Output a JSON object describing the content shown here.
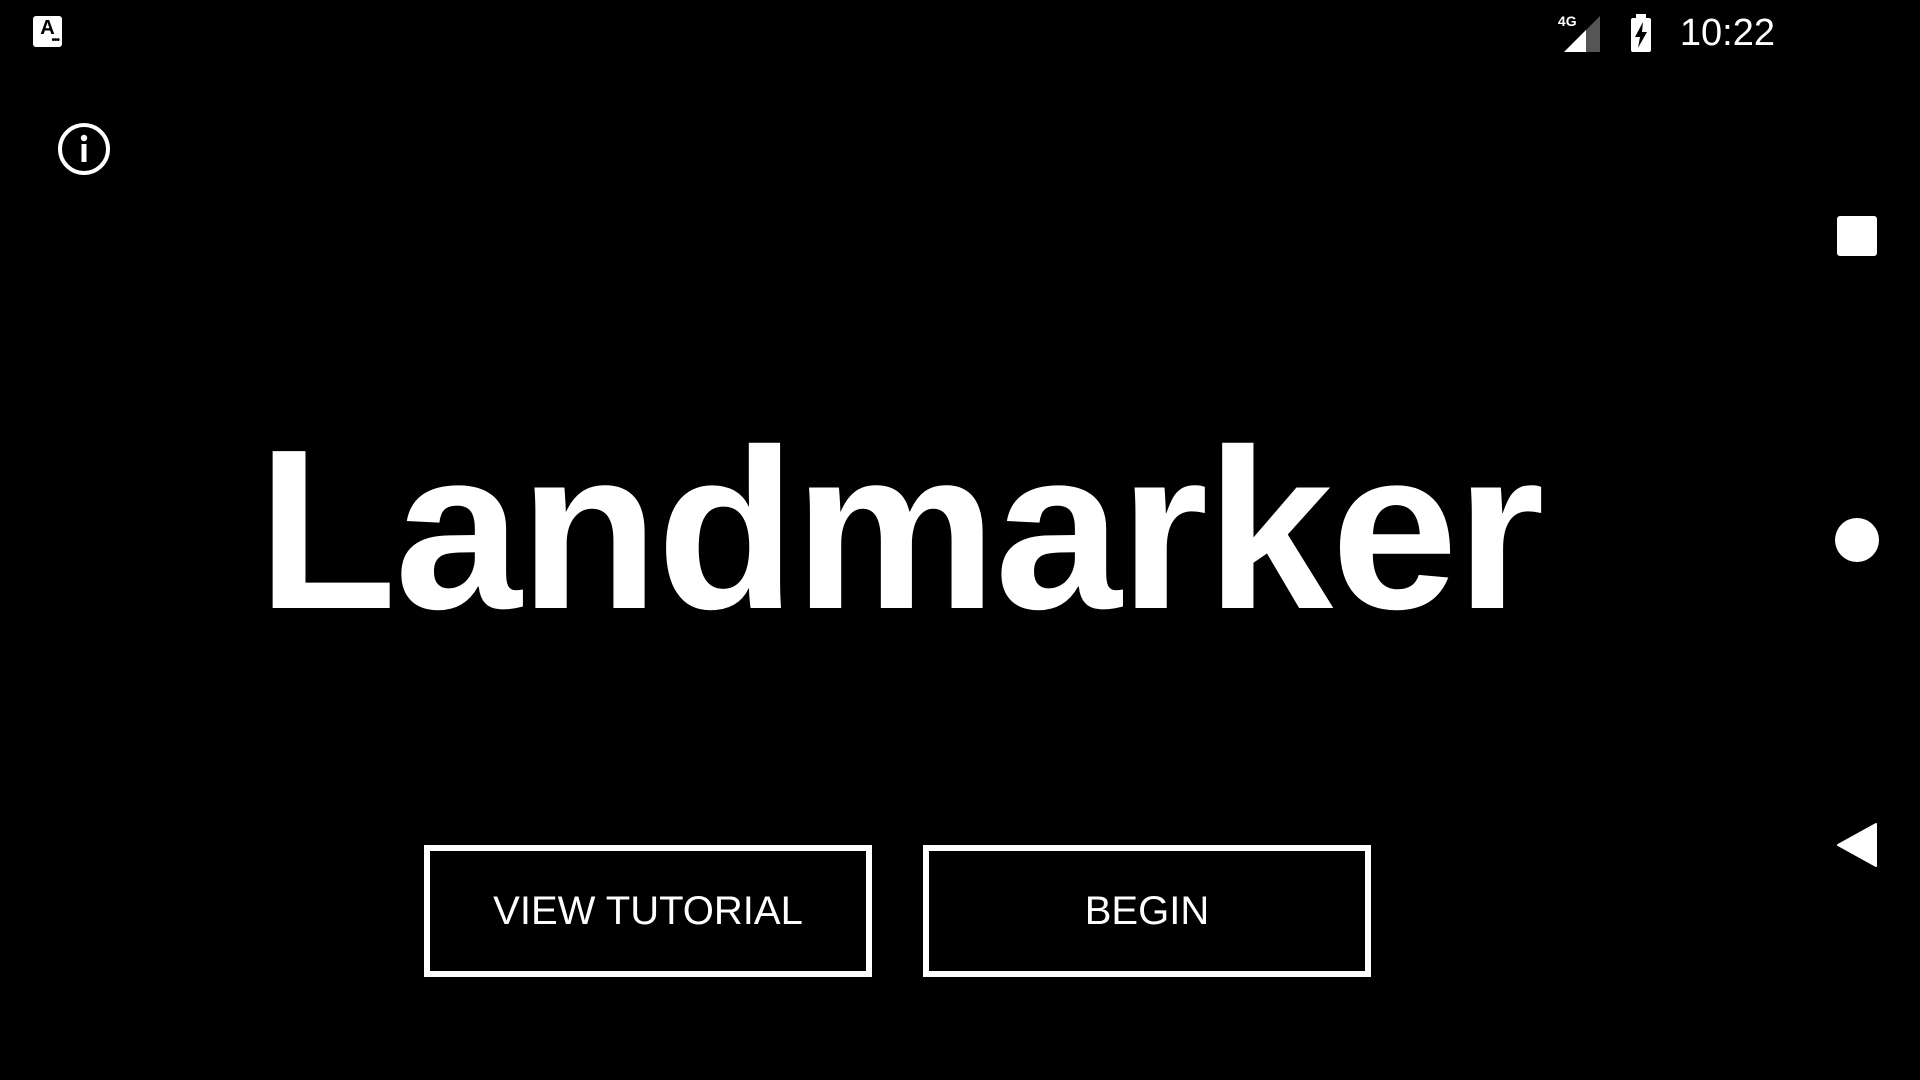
{
  "status_bar": {
    "app_icon_letter": "A",
    "network_type": "4G",
    "time": "10:22",
    "icons": [
      "accessibility-app-icon",
      "signal-icon",
      "battery-charging-icon"
    ]
  },
  "main": {
    "title": "Landmarker",
    "buttons": {
      "tutorial_label": "VIEW TUTORIAL",
      "begin_label": "BEGIN"
    }
  },
  "nav_bar": {
    "icons": [
      "recents-icon",
      "home-icon",
      "back-icon"
    ]
  },
  "colors": {
    "background": "#000000",
    "foreground": "#ffffff"
  }
}
